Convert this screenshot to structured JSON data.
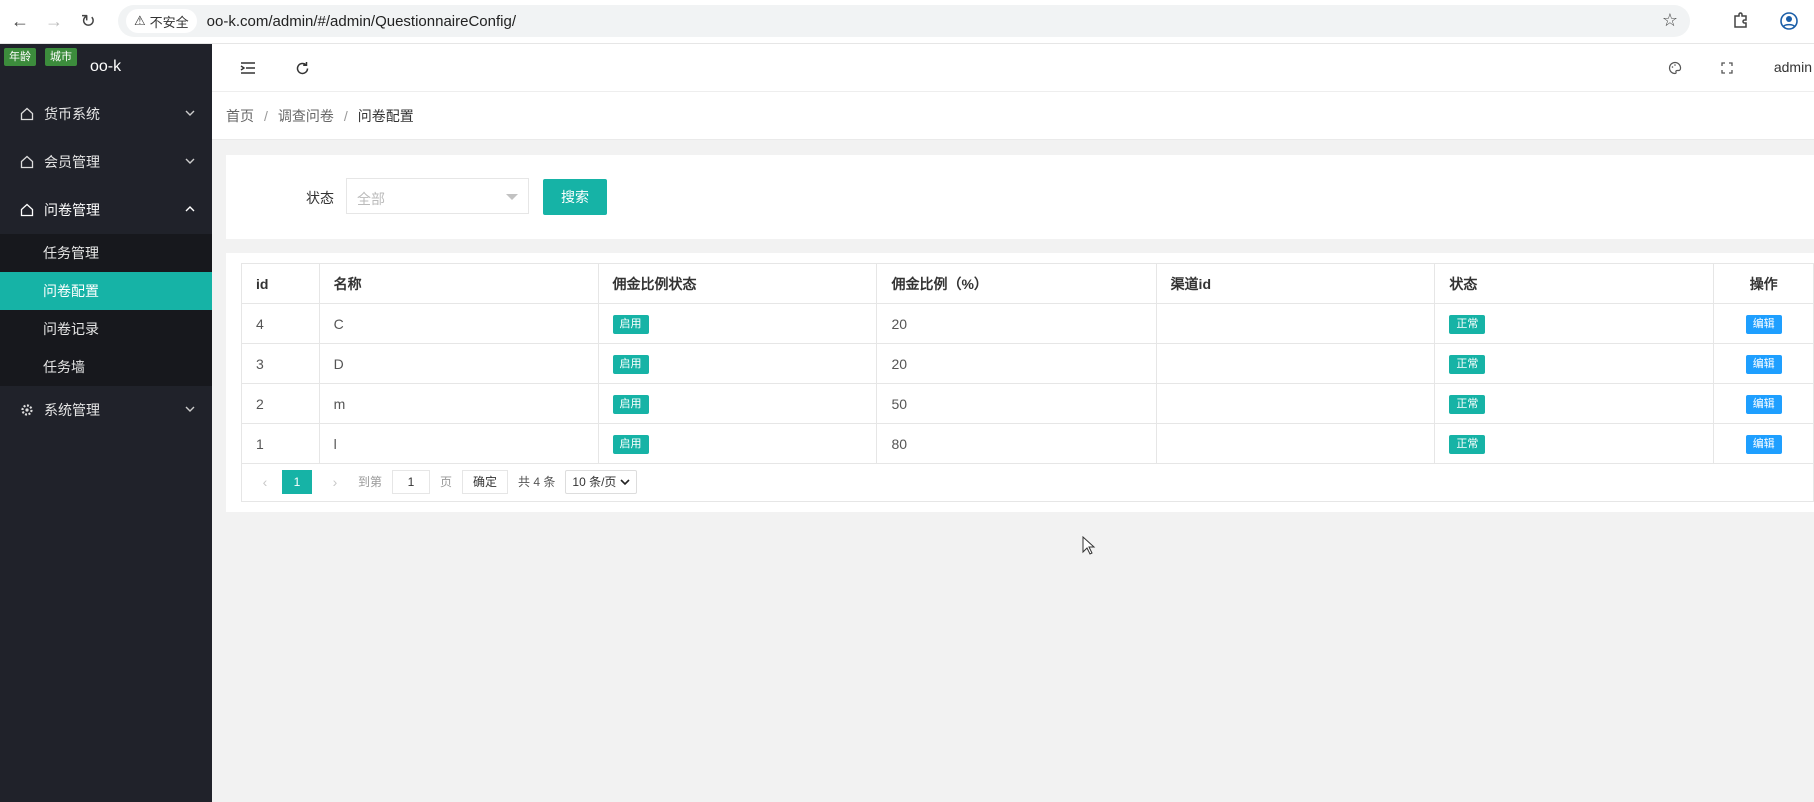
{
  "browser": {
    "security_label": "不安全",
    "url": "oo-k.com/admin/#/admin/QuestionnaireConfig/"
  },
  "sidebar": {
    "tags": [
      "年龄",
      "城市"
    ],
    "logo": "oo-k",
    "menu": [
      {
        "label": "货币系统",
        "expanded": false
      },
      {
        "label": "会员管理",
        "expanded": false
      },
      {
        "label": "问卷管理",
        "expanded": true
      },
      {
        "label": "系统管理",
        "expanded": false
      }
    ],
    "submenu": [
      {
        "label": "任务管理",
        "active": false
      },
      {
        "label": "问卷配置",
        "active": true
      },
      {
        "label": "问卷记录",
        "active": false
      },
      {
        "label": "任务墙",
        "active": false
      }
    ]
  },
  "header": {
    "user": "admin"
  },
  "breadcrumb": [
    "首页",
    "调查问卷",
    "问卷配置"
  ],
  "search": {
    "status_label": "状态",
    "status_placeholder": "全部",
    "search_button": "搜索"
  },
  "table": {
    "columns": [
      "id",
      "名称",
      "佣金比例状态",
      "佣金比例（%）",
      "渠道id",
      "状态",
      "操作"
    ],
    "rows": [
      {
        "id": "4",
        "name": "C",
        "commission_status": "启用",
        "ratio": "20",
        "channel": "",
        "status": "正常",
        "action": "编辑"
      },
      {
        "id": "3",
        "name": "D",
        "commission_status": "启用",
        "ratio": "20",
        "channel": "",
        "status": "正常",
        "action": "编辑"
      },
      {
        "id": "2",
        "name": "m",
        "commission_status": "启用",
        "ratio": "50",
        "channel": "",
        "status": "正常",
        "action": "编辑"
      },
      {
        "id": "1",
        "name": "l",
        "commission_status": "启用",
        "ratio": "80",
        "channel": "",
        "status": "正常",
        "action": "编辑"
      }
    ]
  },
  "pager": {
    "current": "1",
    "goto_label": "到第",
    "goto_value": "1",
    "page_unit": "页",
    "confirm": "确定",
    "total": "共 4 条",
    "page_size": "10 条/页"
  },
  "colors": {
    "accent": "#16b3a6",
    "sidebar_bg": "#20222a",
    "edit_blue": "#1e9fff"
  }
}
